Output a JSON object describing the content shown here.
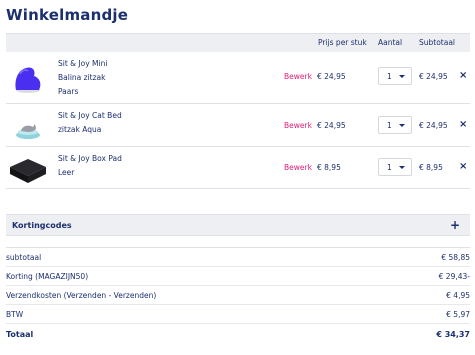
{
  "page": {
    "title": "Winkelmandje"
  },
  "cart": {
    "columns": {
      "price": "Prijs per stuk",
      "quantity": "Aantal",
      "subtotal": "Subtotaal"
    },
    "items": [
      {
        "name_lines": [
          "Sit & Joy Mini",
          "Balina zitzak",
          "Paars"
        ],
        "edit": "Bewerk",
        "price": "€ 24,95",
        "quantity": "1",
        "subtotal": "€ 24,95",
        "remove": "×",
        "image": "purple-beanbag-image"
      },
      {
        "name_lines": [
          "Sit & Joy Cat Bed",
          "zitzak Aqua"
        ],
        "edit": "Bewerk",
        "price": "€ 24,95",
        "quantity": "1",
        "subtotal": "€ 24,95",
        "remove": "×",
        "image": "cat-bed-image"
      },
      {
        "name_lines": [
          "Sit & Joy Box Pad",
          "Leer"
        ],
        "edit": "Bewerk",
        "price": "€ 8,95",
        "quantity": "1",
        "subtotal": "€ 8,95",
        "remove": "×",
        "image": "box-pad-image"
      }
    ]
  },
  "discount": {
    "label": "Kortingcodes",
    "toggle": "+"
  },
  "totals": {
    "rows": [
      {
        "label": "subtotaal",
        "value": "€ 58,85"
      },
      {
        "label": "Korting (MAGAZIJN50)",
        "value": "€ 29,43-"
      },
      {
        "label": "Verzendkosten (Verzenden - Verzenden)",
        "value": "€ 4,95"
      },
      {
        "label": "BTW",
        "value": "€ 5,97"
      }
    ],
    "total": {
      "label": "Totaal",
      "value": "€ 34,37"
    }
  },
  "colors": {
    "navy": "#1c2f6e",
    "pink": "#e0207a",
    "header_bg": "#eeeff3",
    "beanbag_purple": "#4a2ff0"
  }
}
